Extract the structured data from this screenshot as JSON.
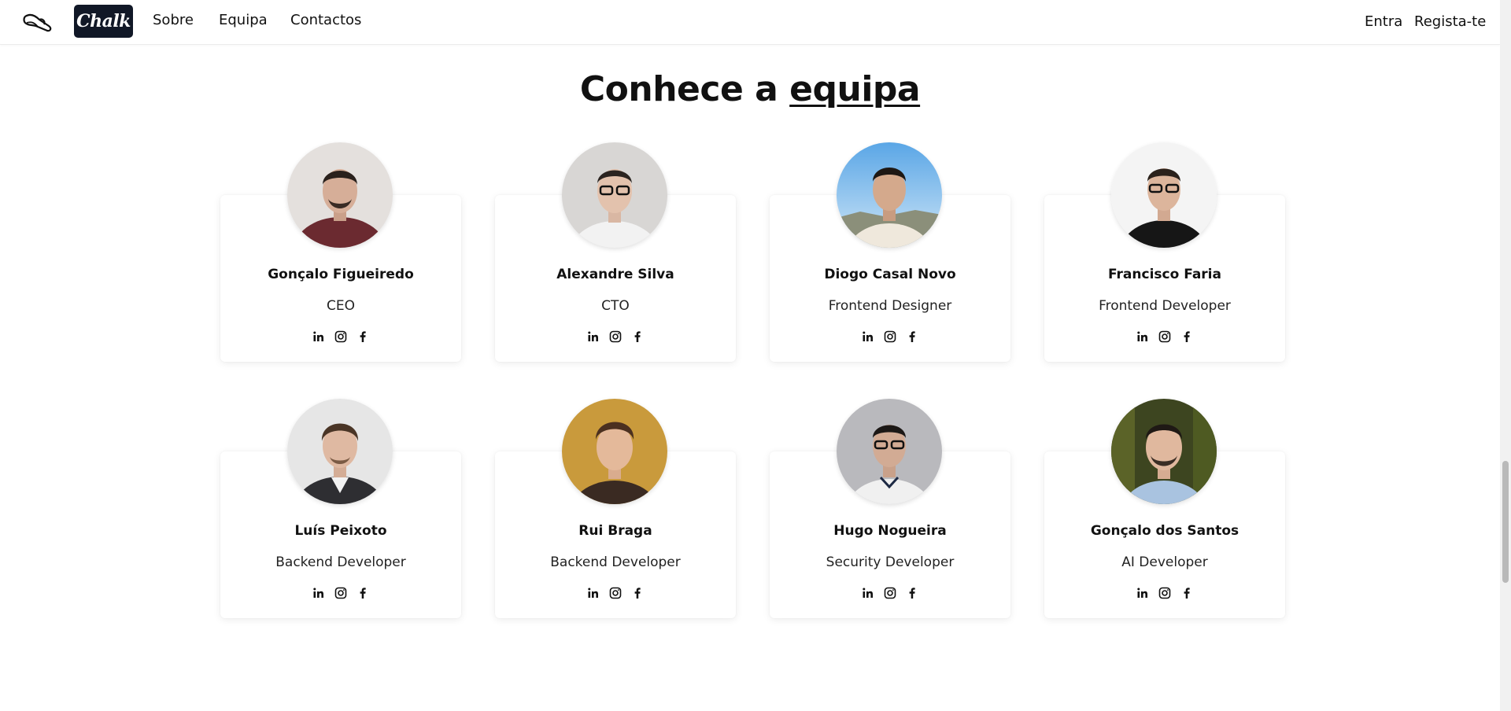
{
  "nav": {
    "brand": "Chalk",
    "links": [
      "Sobre",
      "Equipa",
      "Contactos"
    ],
    "login": "Entra",
    "register": "Regista-te"
  },
  "section": {
    "title_prefix": "Conhece a",
    "title_highlight": "equipa"
  },
  "members": [
    {
      "name": "Gonçalo Figueiredo",
      "role": "CEO"
    },
    {
      "name": "Alexandre Silva",
      "role": "CTO"
    },
    {
      "name": "Diogo Casal Novo",
      "role": "Frontend Designer"
    },
    {
      "name": "Francisco Faria",
      "role": "Frontend Developer"
    },
    {
      "name": "Luís Peixoto",
      "role": "Backend Developer"
    },
    {
      "name": "Rui Braga",
      "role": "Backend Developer"
    },
    {
      "name": "Hugo Nogueira",
      "role": "Security Developer"
    },
    {
      "name": "Gonçalo dos Santos",
      "role": "AI Developer"
    }
  ],
  "social_icons": [
    "linkedin-icon",
    "instagram-icon",
    "facebook-icon"
  ],
  "colors": {
    "brand_badge": "#111827",
    "text": "#111111",
    "card_bg": "#ffffff"
  }
}
